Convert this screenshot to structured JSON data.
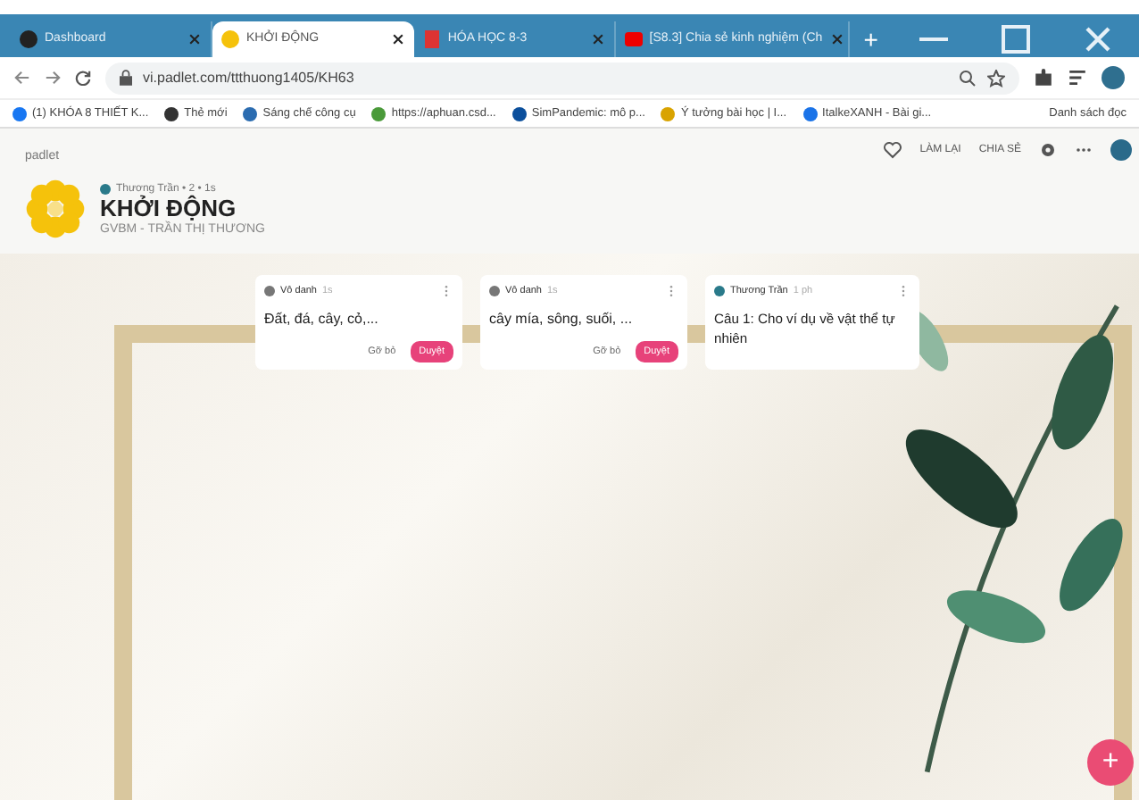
{
  "browser": {
    "tabs": [
      {
        "title": "Dashboard",
        "selected": false
      },
      {
        "title": "KHỞI ĐỘNG",
        "selected": true
      },
      {
        "title": "HÓA HỌC 8-3",
        "selected": false
      },
      {
        "title": "[S8.3] Chia sẻ kinh nghiệm (Ch",
        "selected": false
      }
    ],
    "new_tab": "+",
    "address": "vi.padlet.com/ttthuong1405/KH63",
    "bookmarks": [
      "(1) KHÓA 8 THIẾT K...",
      "Thẻ mới",
      "Sáng chế công cụ",
      "https://aphuan.csd...",
      "SimPandemic: mô p...",
      "Ý tưởng bài học | I...",
      "ItalkeXANH - Bài gi..."
    ],
    "reading_list": "Danh sách đọc"
  },
  "padlet": {
    "brand": "padlet",
    "meta": "Thương Trần • 2 • 1s",
    "title": "KHỞI ĐỘNG",
    "subtitle": "GVBM - TRẦN THỊ THƯƠNG",
    "actions": [
      "LÀM LẠI",
      "CHIA SẺ"
    ]
  },
  "posts": [
    {
      "kind": "pending",
      "author": "Vô danh",
      "time": "1s",
      "text": "Đất, đá, cây, cỏ,...",
      "reject": "Gỡ bỏ",
      "approve": "Duyệt"
    },
    {
      "kind": "pending",
      "author": "Vô danh",
      "time": "1s",
      "text": "cây mía, sông, suối, ...",
      "reject": "Gỡ bỏ",
      "approve": "Duyệt"
    },
    {
      "kind": "post",
      "author": "Thương Trần",
      "time": "1 ph",
      "text": "Câu 1: Cho ví dụ về vật thể tự nhiên"
    }
  ],
  "fab": "+"
}
